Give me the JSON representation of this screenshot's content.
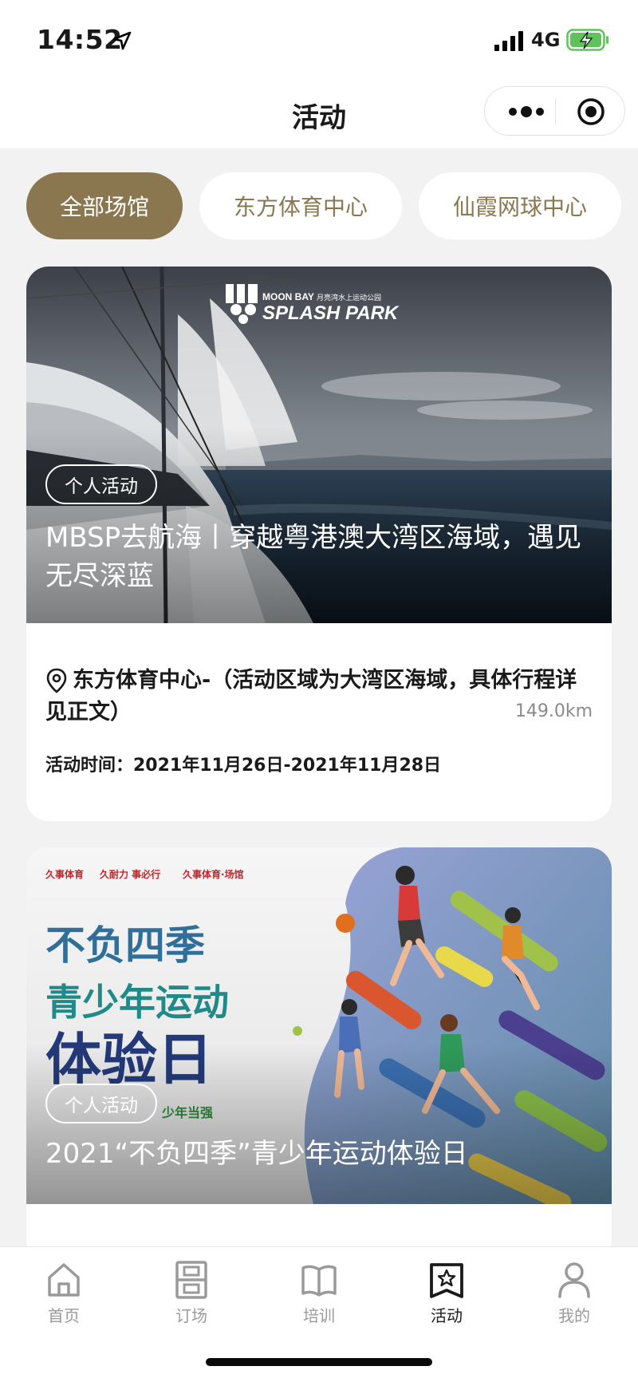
{
  "status_bar": {
    "time": "14:52",
    "network": "4G"
  },
  "nav": {
    "title": "活动"
  },
  "filters": [
    {
      "label": "全部场馆",
      "active": true
    },
    {
      "label": "东方体育中心",
      "active": false
    },
    {
      "label": "仙霞网球中心",
      "active": false
    }
  ],
  "cards": [
    {
      "image_logo": "MOON BAY 月亮湾水上运动公园 SPLASH PARK",
      "tag": "个人活动",
      "title": "MBSP去航海丨穿越粤港澳大湾区海域，遇见无尽深蓝",
      "location": "东方体育中心-（活动区域为大湾区海域，具体行程详见正文）",
      "distance": "149.0km",
      "time": "活动时间：2021年11月26日-2021年11月28日"
    },
    {
      "image_lines": [
        "不负四季",
        "青少年运动",
        "体验日",
        "少年当强"
      ],
      "tag": "个人活动",
      "title": "2021“不负四季”青少年运动体验日"
    }
  ],
  "tabbar": [
    {
      "label": "首页",
      "icon": "home-icon",
      "active": false
    },
    {
      "label": "订场",
      "icon": "court-booking-icon",
      "active": false
    },
    {
      "label": "培训",
      "icon": "book-icon",
      "active": false
    },
    {
      "label": "活动",
      "icon": "activity-star-icon",
      "active": true
    },
    {
      "label": "我的",
      "icon": "user-icon",
      "active": false
    }
  ],
  "colors": {
    "accent": "#8a7750",
    "background": "#f2f2f2"
  }
}
